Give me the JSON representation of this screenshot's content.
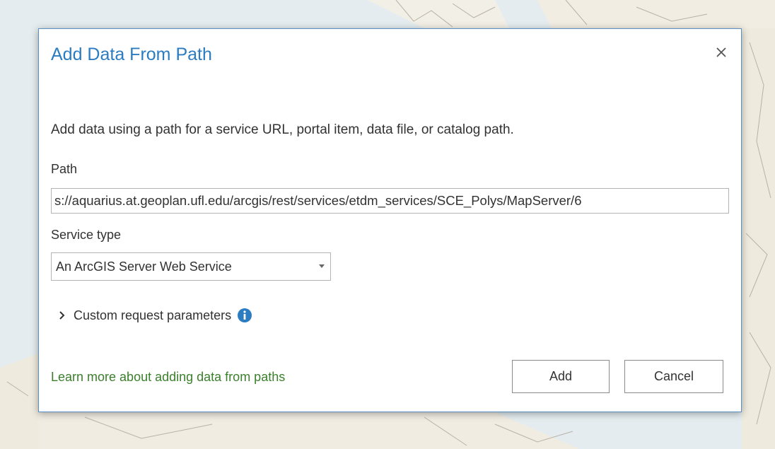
{
  "dialog": {
    "title": "Add Data From Path",
    "close_icon": "close-icon",
    "description": "Add data using a path for a service URL, portal item, data file, or catalog path.",
    "path_label": "Path",
    "path_value": "s://aquarius.at.geoplan.ufl.edu/arcgis/rest/services/etdm_services/SCE_Polys/MapServer/6",
    "service_type_label": "Service type",
    "service_type_value": "An ArcGIS Server Web Service",
    "custom_params_label": "Custom request parameters",
    "learn_more_link": "Learn more about adding data from paths",
    "add_label": "Add",
    "cancel_label": "Cancel"
  },
  "colors": {
    "title": "#2b7cc1",
    "link": "#3b7f2c",
    "info_icon": "#2b7cc1",
    "dialog_border": "#5b8fc4"
  }
}
